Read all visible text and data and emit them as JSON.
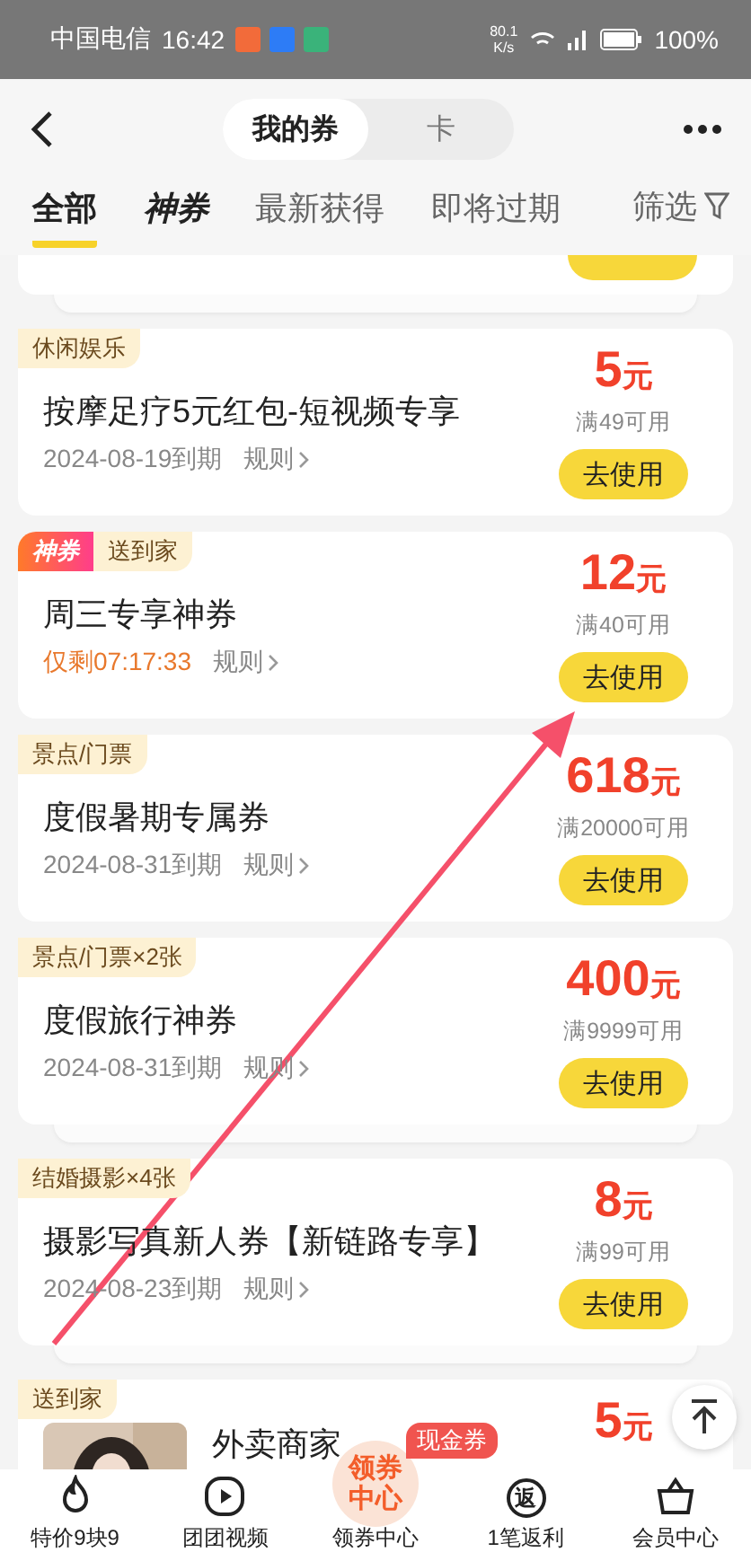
{
  "status_bar": {
    "carrier": "中国电信",
    "time": "16:42",
    "speed": "80.1",
    "speed_unit": "K/s",
    "battery": "100%"
  },
  "header": {
    "segments": [
      {
        "label": "我的券",
        "selected": true
      },
      {
        "label": "卡",
        "selected": false
      }
    ]
  },
  "filter_tabs": [
    {
      "label": "全部",
      "selected": true,
      "kind": "plain"
    },
    {
      "label": "神券",
      "selected": false,
      "kind": "brand"
    },
    {
      "label": "最新获得",
      "selected": false,
      "kind": "plain"
    },
    {
      "label": "即将过期",
      "selected": false,
      "kind": "plain"
    }
  ],
  "filter": {
    "label": "筛选"
  },
  "coupons": [
    {
      "kind": "stub",
      "stacked": true
    },
    {
      "kind": "full",
      "stacked": false,
      "tags": [
        {
          "label": "休闲娱乐",
          "kind": "plain"
        }
      ],
      "title": "按摩足疗5元红包-短视频专享",
      "expiry": "2024-08-19到期",
      "urgent": false,
      "rules": "规则",
      "amount": "5",
      "unit": "元",
      "condition": "满49可用",
      "button": "去使用"
    },
    {
      "kind": "full",
      "stacked": false,
      "tags": [
        {
          "label": "神券",
          "kind": "brand"
        },
        {
          "label": "送到家",
          "kind": "plain"
        }
      ],
      "title": "周三专享神券",
      "expiry": "仅剩07:17:33",
      "urgent": true,
      "rules": "规则",
      "amount": "12",
      "unit": "元",
      "condition": "满40可用",
      "button": "去使用"
    },
    {
      "kind": "full",
      "stacked": false,
      "tags": [
        {
          "label": "景点/门票",
          "kind": "plain"
        }
      ],
      "title": "度假暑期专属券",
      "expiry": "2024-08-31到期",
      "urgent": false,
      "rules": "规则",
      "amount": "618",
      "unit": "元",
      "condition": "满20000可用",
      "button": "去使用"
    },
    {
      "kind": "full",
      "stacked": true,
      "tags": [
        {
          "label": "景点/门票×2张",
          "kind": "plain"
        }
      ],
      "title": "度假旅行神券",
      "expiry": "2024-08-31到期",
      "urgent": false,
      "rules": "规则",
      "amount": "400",
      "unit": "元",
      "condition": "满9999可用",
      "button": "去使用"
    },
    {
      "kind": "full",
      "stacked": true,
      "tags": [
        {
          "label": "结婚摄影×4张",
          "kind": "plain"
        }
      ],
      "title": "摄影写真新人券【新链路专享】",
      "expiry": "2024-08-23到期",
      "urgent": false,
      "rules": "规则",
      "amount": "8",
      "unit": "元",
      "condition": "满99可用",
      "button": "去使用"
    },
    {
      "tags": [
        {
          "label": "送到家",
          "kind": "plain"
        }
      ],
      "title": "外卖商家",
      "amount": "5",
      "unit": "元"
    }
  ],
  "cash_badge": "现金券",
  "bottom_nav": [
    {
      "label": "特价9块9",
      "kind": "flame"
    },
    {
      "label": "团团视频",
      "kind": "play"
    },
    {
      "label": "领券中心",
      "kind": "center",
      "circle": [
        "领券",
        "中心"
      ]
    },
    {
      "label": "1笔返利",
      "kind": "glyph",
      "glyph": "返"
    },
    {
      "label": "会员中心",
      "kind": "basket"
    }
  ]
}
